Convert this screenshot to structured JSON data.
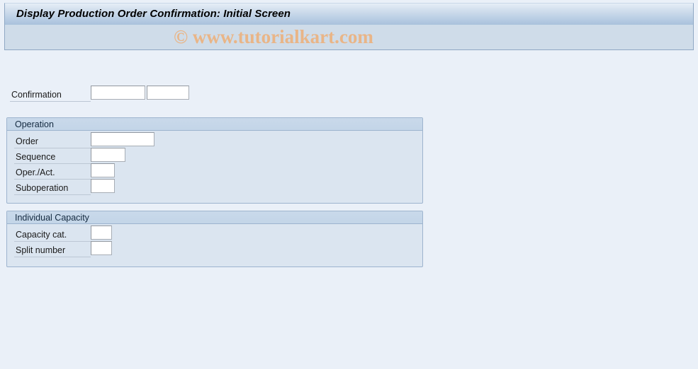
{
  "window": {
    "title": "Display Production Order Confirmation: Initial Screen"
  },
  "watermark": {
    "text": "© www.tutorialkart.com",
    "color": "#e9b587"
  },
  "theme": {
    "title_bar_start": "#e6eef7",
    "title_bar_end": "#a9c1dc",
    "toolbar_bg": "#cfdce9",
    "content_bg": "#eaf0f8",
    "group_bg": "#dbe5f0",
    "group_header_bg": "#c5d6e9",
    "group_border": "#9db4ce",
    "input_bg": "#ffffff",
    "input_border": "#a7adb5",
    "label_color": "#1a1a1a"
  },
  "main": {
    "confirmation": {
      "label": "Confirmation",
      "input_1": {
        "value": "",
        "placeholder": ""
      },
      "input_2": {
        "value": "",
        "placeholder": ""
      }
    },
    "groups": [
      {
        "id": "operation",
        "title": "Operation",
        "fields": [
          {
            "label": "Order",
            "value": "",
            "placeholder": ""
          },
          {
            "label": "Sequence",
            "value": "",
            "placeholder": ""
          },
          {
            "label": "Oper./Act.",
            "value": "",
            "placeholder": ""
          },
          {
            "label": "Suboperation",
            "value": "",
            "placeholder": ""
          }
        ]
      },
      {
        "id": "individual_capacity",
        "title": "Individual Capacity",
        "fields": [
          {
            "label": "Capacity cat.",
            "value": "",
            "placeholder": ""
          },
          {
            "label": "Split number",
            "value": "",
            "placeholder": ""
          }
        ]
      }
    ]
  }
}
